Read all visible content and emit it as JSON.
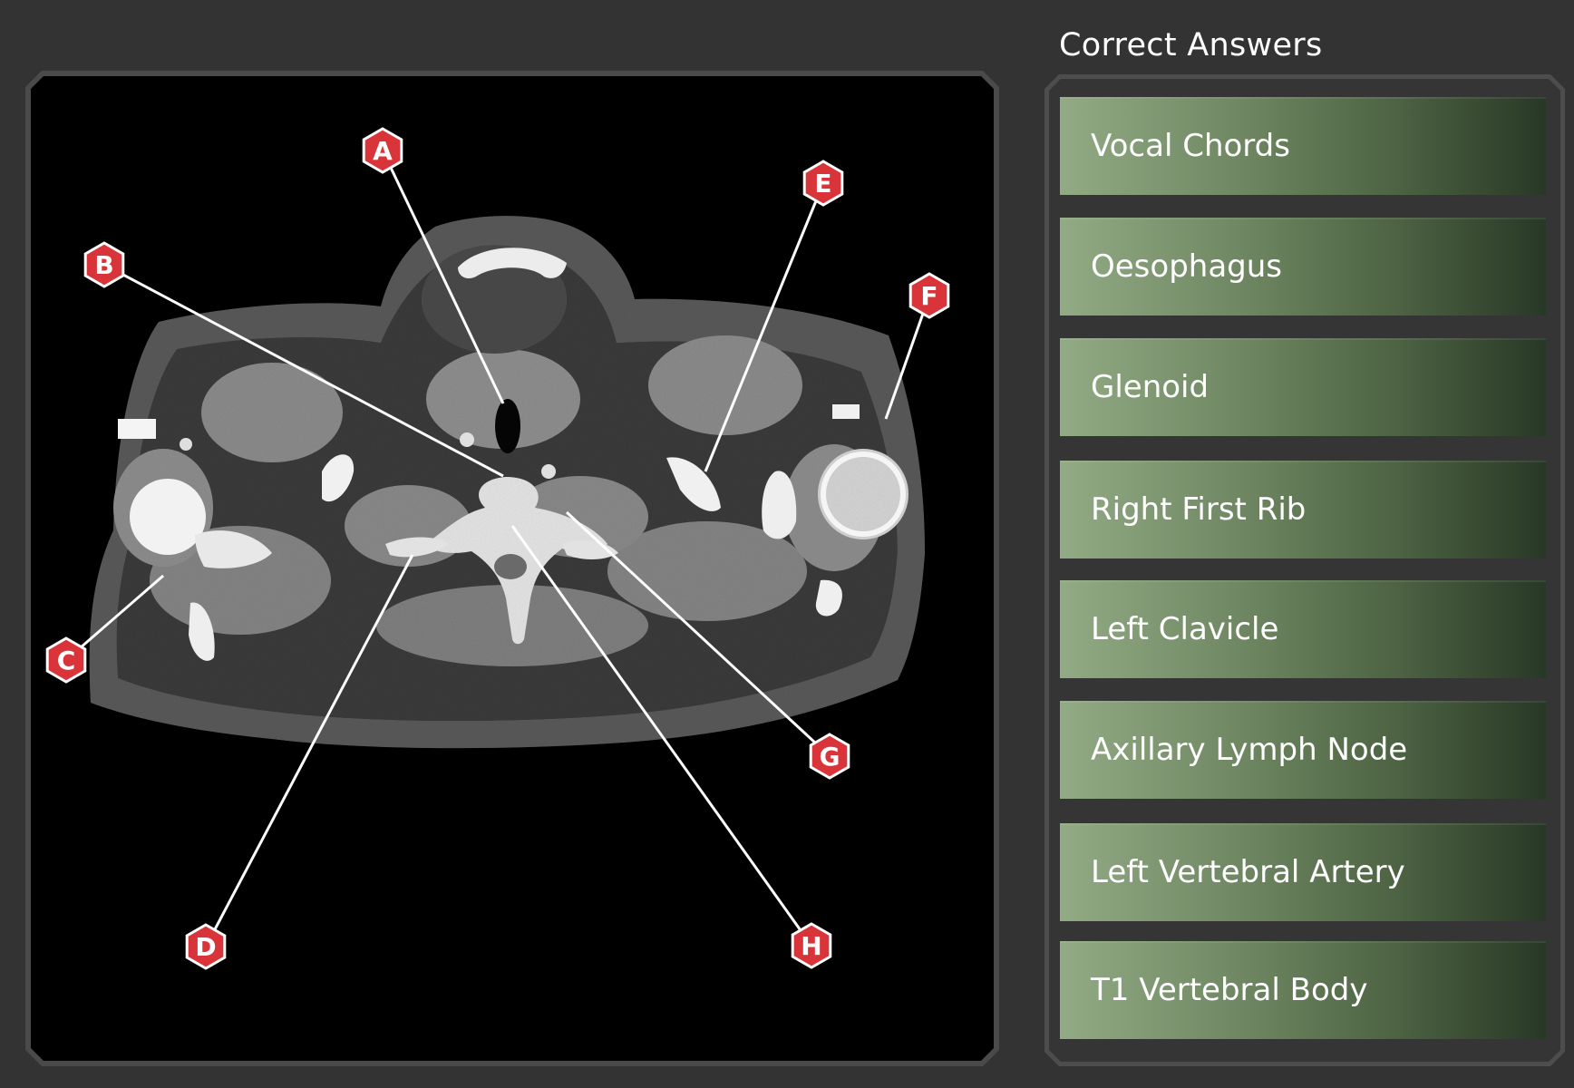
{
  "viewer": {
    "markers": [
      {
        "letter": "A"
      },
      {
        "letter": "B"
      },
      {
        "letter": "C"
      },
      {
        "letter": "D"
      },
      {
        "letter": "E"
      },
      {
        "letter": "F"
      },
      {
        "letter": "G"
      },
      {
        "letter": "H"
      }
    ],
    "marker_color": "#d9343a"
  },
  "answers": {
    "title": "Correct Answers",
    "items": [
      {
        "label": "Vocal Chords"
      },
      {
        "label": "Oesophagus"
      },
      {
        "label": "Glenoid"
      },
      {
        "label": "Right First Rib"
      },
      {
        "label": "Left Clavicle"
      },
      {
        "label": "Axillary Lymph Node"
      },
      {
        "label": "Left Vertebral Artery"
      },
      {
        "label": "T1 Vertebral Body"
      }
    ],
    "item_gradient": [
      "#93ab85",
      "#283826"
    ]
  }
}
